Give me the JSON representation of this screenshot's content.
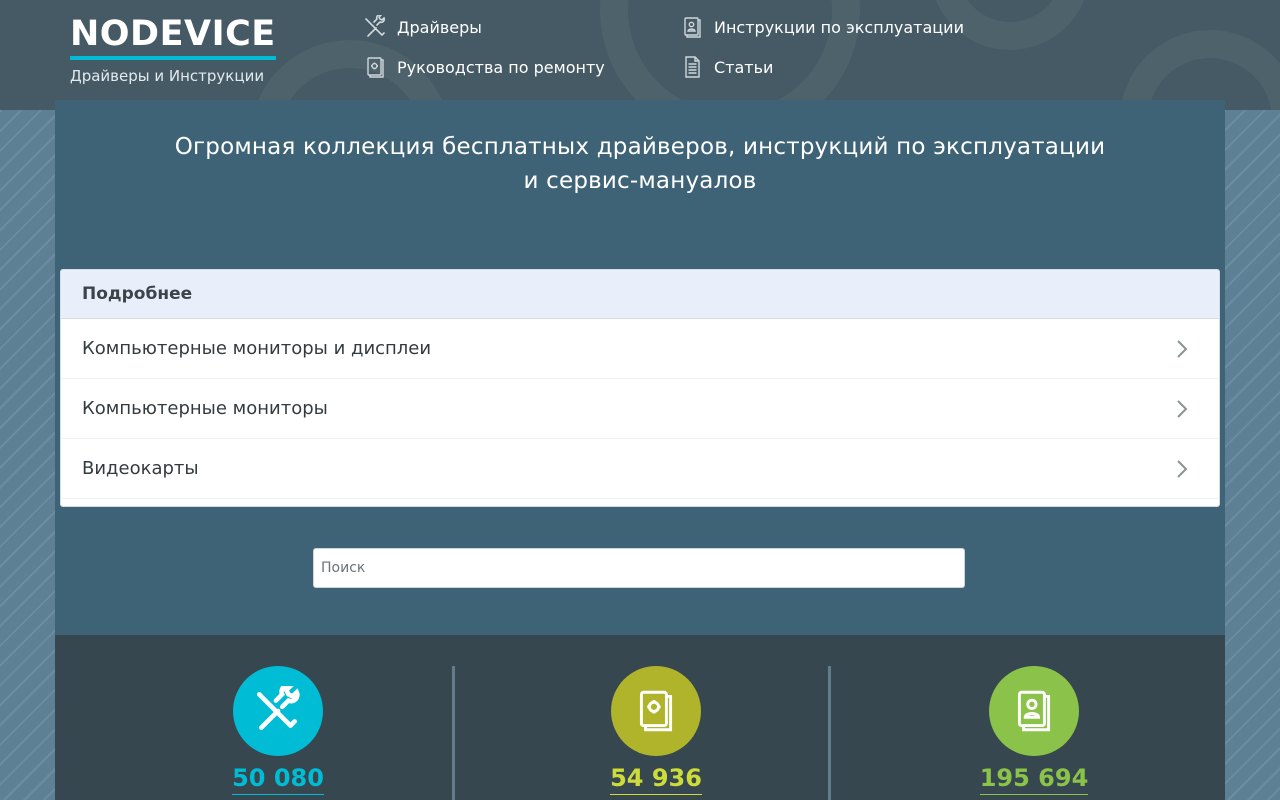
{
  "header": {
    "logo": "NODEVICE",
    "subtitle": "Драйверы и Инструкции",
    "nav": [
      {
        "label": "Драйверы",
        "icon": "tools-icon"
      },
      {
        "label": "Руководства по ремонту",
        "icon": "repair-manual-icon"
      },
      {
        "label": "Инструкции по эксплуатации",
        "icon": "user-manual-icon"
      },
      {
        "label": "Статьи",
        "icon": "document-icon"
      }
    ]
  },
  "hero": {
    "line1": "Огромная коллекция бесплатных драйверов, инструкций по эксплуатации",
    "line2": "и сервис-мануалов"
  },
  "details": {
    "title": "Подробнее",
    "items": [
      {
        "label": "Компьютерные мониторы и дисплеи"
      },
      {
        "label": "Компьютерные мониторы"
      },
      {
        "label": "Видеокарты"
      }
    ]
  },
  "search": {
    "placeholder": "Поиск",
    "value": ""
  },
  "stats": [
    {
      "value": "50 080",
      "color": "#00bcd4",
      "icon": "tools-icon"
    },
    {
      "value": "54 936",
      "color": "#afb42b",
      "icon": "repair-manual-icon"
    },
    {
      "value": "195 694",
      "color": "#8bc34a",
      "icon": "user-manual-icon"
    }
  ],
  "colors": {
    "header_bg": "#455a64",
    "panel_bg": "#3f6376",
    "stats_bg": "#37474f",
    "accent": "#00bcd4"
  }
}
